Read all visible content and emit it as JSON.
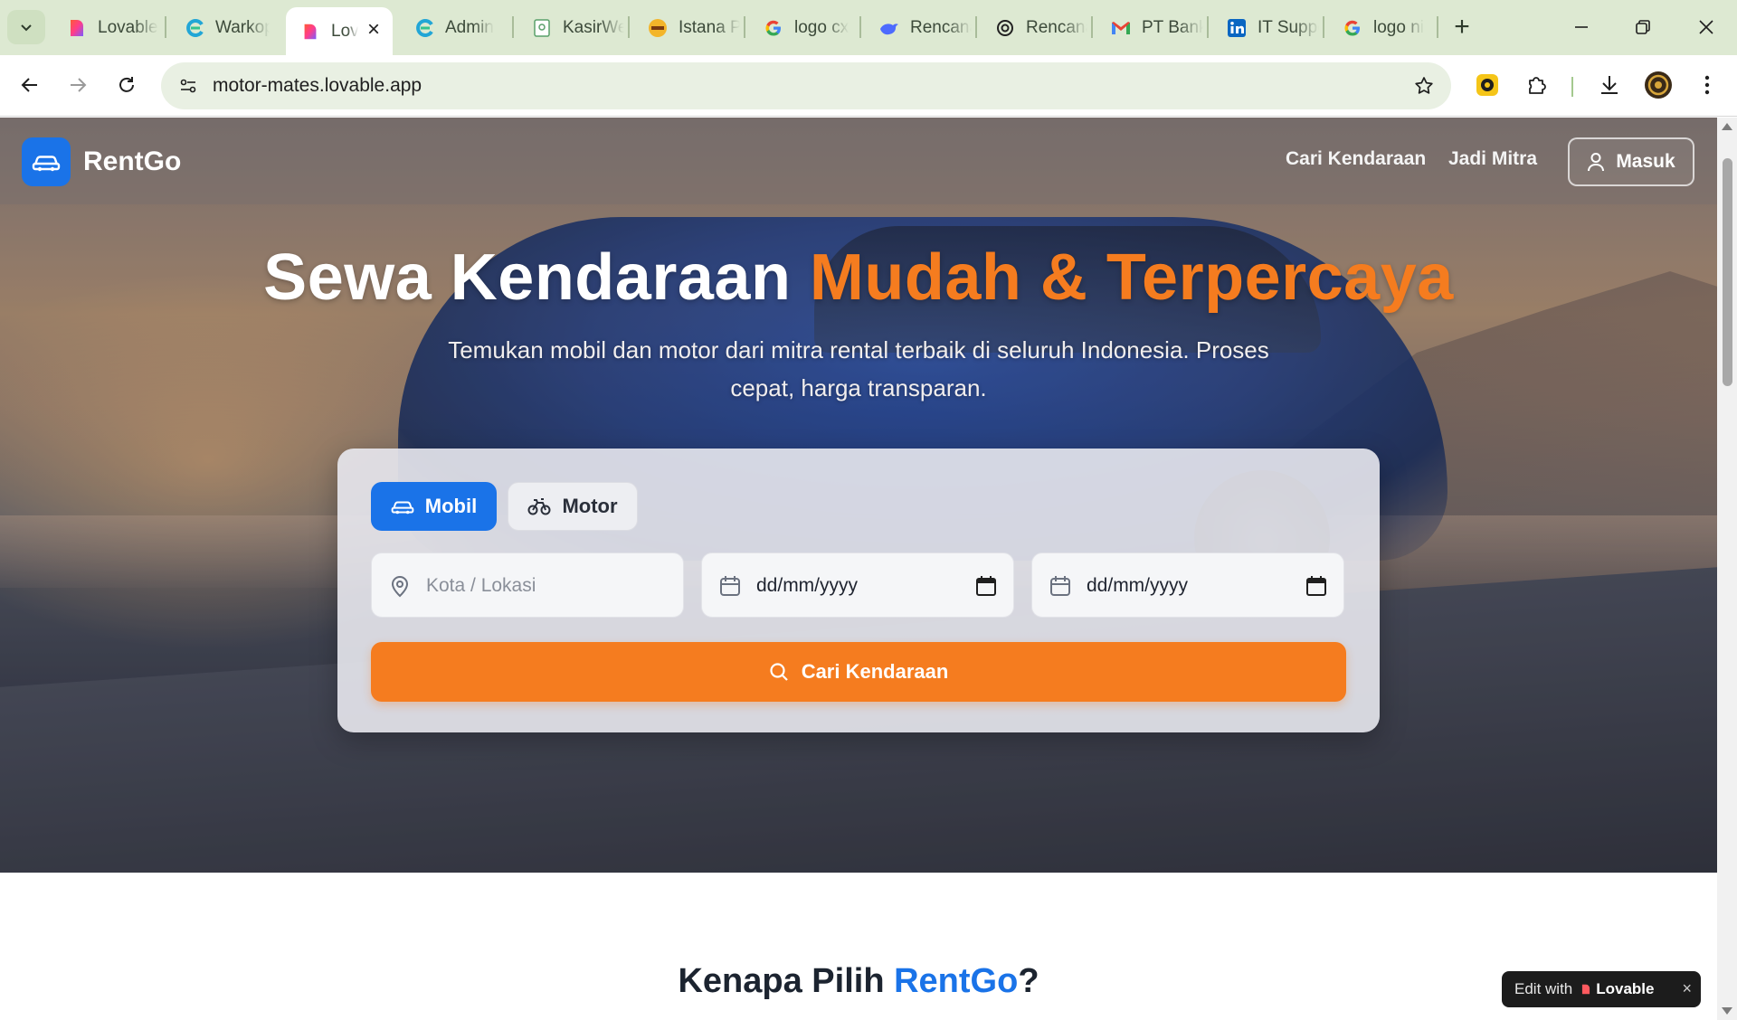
{
  "browser": {
    "tabs": [
      {
        "title": "Lovable",
        "icon": "lovable-heart-icon",
        "active": false
      },
      {
        "title": "Warkop",
        "icon": "curved-e-icon",
        "active": false
      },
      {
        "title": "Lovable",
        "icon": "lovable-heart-icon",
        "active": true
      },
      {
        "title": "Admin",
        "icon": "curved-e-icon",
        "active": false
      },
      {
        "title": "KasirWeb",
        "icon": "doc-icon",
        "active": false
      },
      {
        "title": "Istana P",
        "icon": "istana-logo-icon",
        "active": false
      },
      {
        "title": "logo cx",
        "icon": "google-icon",
        "active": false
      },
      {
        "title": "Rencana",
        "icon": "whale-icon",
        "active": false
      },
      {
        "title": "Rencana",
        "icon": "openai-icon",
        "active": false
      },
      {
        "title": "PT Bank",
        "icon": "gmail-icon",
        "active": false
      },
      {
        "title": "IT Support",
        "icon": "linkedin-icon",
        "active": false
      },
      {
        "title": "logo ni",
        "icon": "google-icon",
        "active": false
      }
    ],
    "url": "motor-mates.lovable.app"
  },
  "site": {
    "brand": "RentGo",
    "nav": {
      "search": "Cari Kendaraan",
      "partner": "Jadi Mitra",
      "login": "Masuk"
    },
    "hero": {
      "title_main": "Sewa Kendaraan ",
      "title_accent": "Mudah & Terpercaya",
      "subtitle": "Temukan mobil dan motor dari mitra rental terbaik di seluruh Indonesia. Proses cepat, harga transparan."
    },
    "search": {
      "type_car": "Mobil",
      "type_bike": "Motor",
      "location_placeholder": "Kota / Lokasi",
      "start_date": "dd/mm/yyyy",
      "end_date": "dd/mm/yyyy",
      "button": "Cari Kendaraan"
    },
    "why": {
      "prefix": "Kenapa Pilih ",
      "brand": "RentGo",
      "suffix": "?"
    },
    "badge": {
      "edit": "Edit with",
      "name": "Lovable",
      "close": "×"
    }
  },
  "colors": {
    "brand_blue": "#1a73e8",
    "accent_orange": "#f57c1f",
    "chrome_green": "#dde9d2"
  }
}
